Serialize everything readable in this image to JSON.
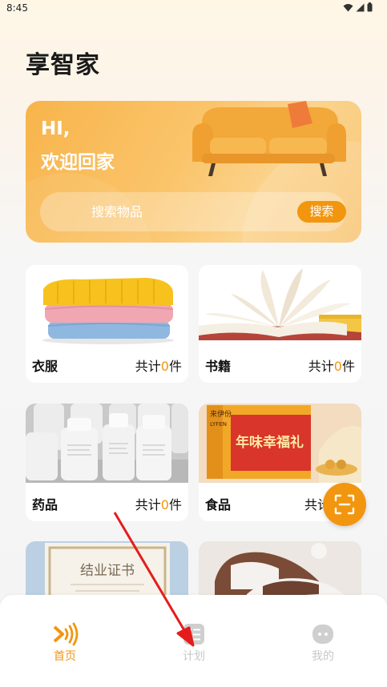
{
  "status_bar": {
    "time": "8:45"
  },
  "app": {
    "title": "享智家"
  },
  "banner": {
    "greeting_line1": "HI,",
    "greeting_line2": "欢迎回家",
    "search_placeholder": "搜索物品",
    "search_button": "搜索"
  },
  "categories": [
    {
      "name": "衣服",
      "count_prefix": "共计",
      "count": "0",
      "count_suffix": "件",
      "image": "sweater-image"
    },
    {
      "name": "书籍",
      "count_prefix": "共计",
      "count": "0",
      "count_suffix": "件",
      "image": "book-image"
    },
    {
      "name": "药品",
      "count_prefix": "共计",
      "count": "0",
      "count_suffix": "件",
      "image": "medicine-bottles-image"
    },
    {
      "name": "食品",
      "count_prefix": "共计",
      "image": "food-box-image"
    },
    {
      "image": "certificate-image",
      "image_text": "结业证书"
    },
    {
      "image": "sneakers-image"
    }
  ],
  "food_box_text": {
    "brand": "来伊份",
    "brand_en": "LYFEN",
    "title": "年味幸福礼"
  },
  "tabs": [
    {
      "label": "首页",
      "icon": "home-signal-icon",
      "active": true
    },
    {
      "label": "计划",
      "icon": "plan-list-icon",
      "active": false
    },
    {
      "label": "我的",
      "icon": "profile-chat-icon",
      "active": false
    }
  ],
  "colors": {
    "accent": "#f2960f",
    "inactive": "#c8c8c8"
  }
}
